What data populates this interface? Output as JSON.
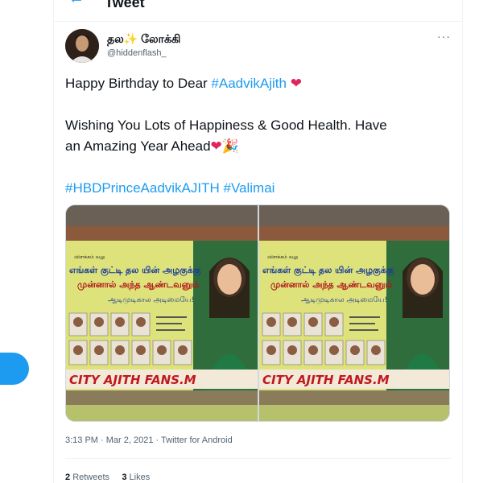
{
  "header": {
    "title": "Tweet",
    "back_icon": "arrow-left-icon"
  },
  "author": {
    "display_name": "தல",
    "display_name_sparkle": "✨",
    "display_name_suffix": " லோக்கி",
    "handle": "@hiddenflash_"
  },
  "tweet": {
    "line1_text": "Happy Birthday to Dear ",
    "line1_hashtag": "#AadvikAjith",
    "line1_emoji": " ❤",
    "line2_text": "Wishing You Lots of Happiness & Good Health.  Have",
    "line3_text": "an Amazing Year Ahead",
    "line3_emoji": "❤🎉",
    "hashtag1": "#HBDPrinceAadvikAJITH",
    "hashtag2": "#Valimai"
  },
  "media": {
    "banner_header": "விளக்கம் வலு",
    "banner_line1": "எங்கள் குட்டி தல யின் அழகுக்கு",
    "banner_line2": "முன்னால் அந்த ஆண்டவனும்",
    "banner_line3": "ஆடிமுடிகால அடிமையே!",
    "banner_footer": "CITY AJITH FANS.M"
  },
  "meta": {
    "time": "3:13 PM",
    "date": "Mar 2, 2021",
    "source": "Twitter for Android",
    "sep": " · "
  },
  "stats": {
    "retweets_count": "2",
    "retweets_label": "Retweets",
    "likes_count": "3",
    "likes_label": "Likes"
  },
  "colors": {
    "accent": "#1d9bf0",
    "heart": "#e0245e",
    "muted": "#536471"
  }
}
